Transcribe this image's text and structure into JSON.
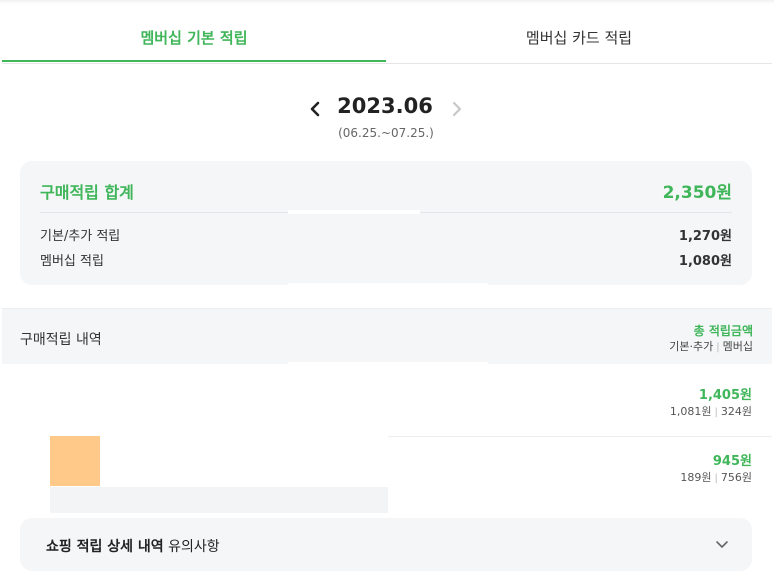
{
  "tabs": {
    "basic": "멤버십 기본 적립",
    "card": "멤버십 카드 적립"
  },
  "month": {
    "title": "2023.06",
    "range": "(06.25.~07.25.)"
  },
  "summary": {
    "title": "구매적립 합계",
    "total": "2,350원",
    "rows": [
      {
        "label": "기본/추가 적립",
        "value": "1,270원"
      },
      {
        "label": "멤버십 적립",
        "value": "1,080원"
      }
    ]
  },
  "history": {
    "title": "구매적립 내역",
    "legend_total": "총 적립금액",
    "legend_basic": "기본·추가",
    "legend_membership": "멤버십",
    "entries": [
      {
        "total": "1,405원",
        "basic": "1,081원",
        "membership": "324원"
      },
      {
        "total": "945원",
        "basic": "189원",
        "membership": "756원"
      }
    ]
  },
  "notice": {
    "bold": "쇼핑 적립 상세 내역",
    "normal": "유의사항"
  },
  "colors": {
    "accent": "#40b65a",
    "card_bg": "#f5f6f8",
    "thumb": "#ffc98a"
  },
  "icons": {
    "prev": "chevron-left-icon",
    "next": "chevron-right-icon",
    "expand": "chevron-down-icon"
  }
}
